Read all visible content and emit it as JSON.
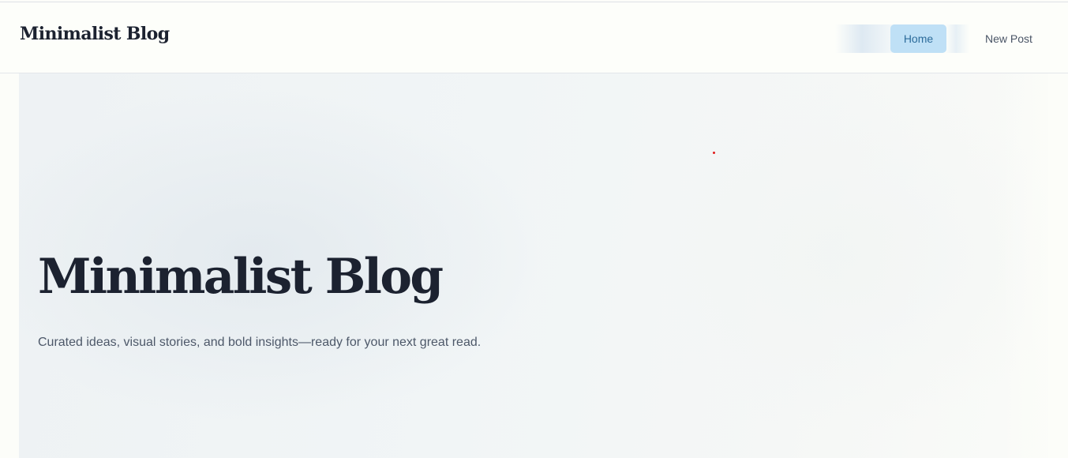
{
  "header": {
    "brand": "Minimalist Blog",
    "nav": {
      "home_label": "Home",
      "new_post_label": "New Post",
      "active": "Home"
    }
  },
  "hero": {
    "title": "Minimalist Blog",
    "subtitle": "Curated ideas, visual stories, and bold insights—ready for your next great read."
  },
  "colors": {
    "page_background": "#fcfdf9",
    "text_primary": "#1c2230",
    "text_secondary": "#4d5869",
    "nav_active_background": "#bfe0f6",
    "nav_active_text": "#2d6c9b",
    "cursor_dot": "#e01b1b"
  }
}
